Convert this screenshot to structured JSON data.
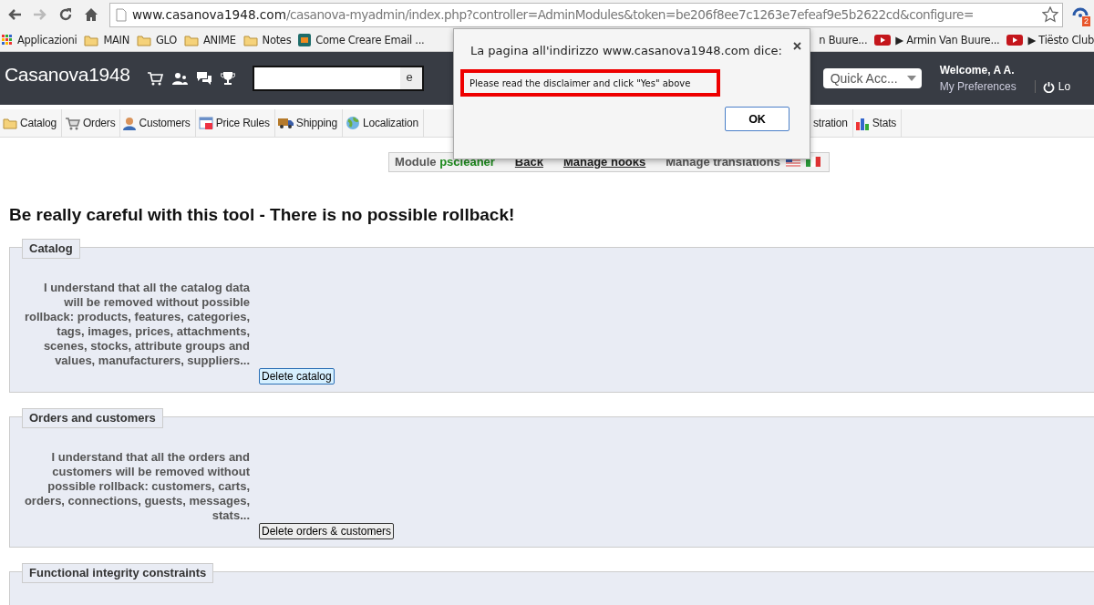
{
  "browser": {
    "nav": [
      {
        "kind": "back",
        "disabled": false
      },
      {
        "kind": "forward",
        "disabled": true
      },
      {
        "kind": "reload",
        "disabled": false
      },
      {
        "kind": "home",
        "disabled": false
      }
    ],
    "url": {
      "host": "www.casanova1948.com",
      "path": "/casanova-myadmin/index.php?controller=AdminModules&token=be206f8ee7c1263e7efeaf9e5b2622cd&configure="
    },
    "extension_badge": "2",
    "bookmarks_left": [
      {
        "kind": "apps",
        "label": "Applicazioni"
      },
      {
        "kind": "folder",
        "label": "MAIN"
      },
      {
        "kind": "folder",
        "label": "GLO"
      },
      {
        "kind": "folder",
        "label": "ANIME"
      },
      {
        "kind": "folder",
        "label": "Notes"
      },
      {
        "kind": "site",
        "label": "Come Creare Email ..."
      }
    ],
    "bookmarks_right": [
      {
        "kind": "text",
        "label": "n Buure..."
      },
      {
        "kind": "video",
        "label": "▶ Armin Van Buure..."
      },
      {
        "kind": "video",
        "label": "▶ Tiësto Club"
      }
    ]
  },
  "header": {
    "logo": "Casanova1948",
    "search_segment": "e",
    "quick_access": "Quick Acc...",
    "welcome": "Welcome, A A.",
    "preferences": "My Preferences",
    "logout": "Lo"
  },
  "menu_left": [
    {
      "kind": "folder",
      "label": "Catalog"
    },
    {
      "kind": "cart",
      "label": "Orders"
    },
    {
      "kind": "person",
      "label": "Customers"
    },
    {
      "kind": "tag",
      "label": "Price Rules"
    },
    {
      "kind": "truck",
      "label": "Shipping"
    },
    {
      "kind": "globe",
      "label": "Localization"
    }
  ],
  "menu_right": [
    {
      "kind": "plain",
      "label": "stration"
    },
    {
      "kind": "bars",
      "label": "Stats"
    }
  ],
  "module_bar": {
    "label": "Module",
    "name": "pscleaner",
    "links": [
      "Back",
      "Manage hooks",
      "Manage translations"
    ]
  },
  "warning": "Be really careful with this tool - There is no possible rollback!",
  "sections": [
    {
      "legend": "Catalog",
      "text": "I understand that all the catalog data will be removed without possible rollback: products, features, categories, tags, images, prices, attachments, scenes, stocks, attribute groups and values, manufacturers, suppliers...",
      "button": "Delete catalog",
      "focused": true
    },
    {
      "legend": "Orders and customers",
      "text": "I understand that all the orders and customers will be removed without possible rollback: customers, carts, orders, connections, guests, messages, stats...",
      "button": "Delete orders & customers",
      "focused": false
    },
    {
      "legend": "Functional integrity constraints"
    }
  ],
  "dialog": {
    "title": "La pagina all'indirizzo www.casanova1948.com dice:",
    "message": "Please read the disclaimer and click \"Yes\" above",
    "button": "OK"
  }
}
